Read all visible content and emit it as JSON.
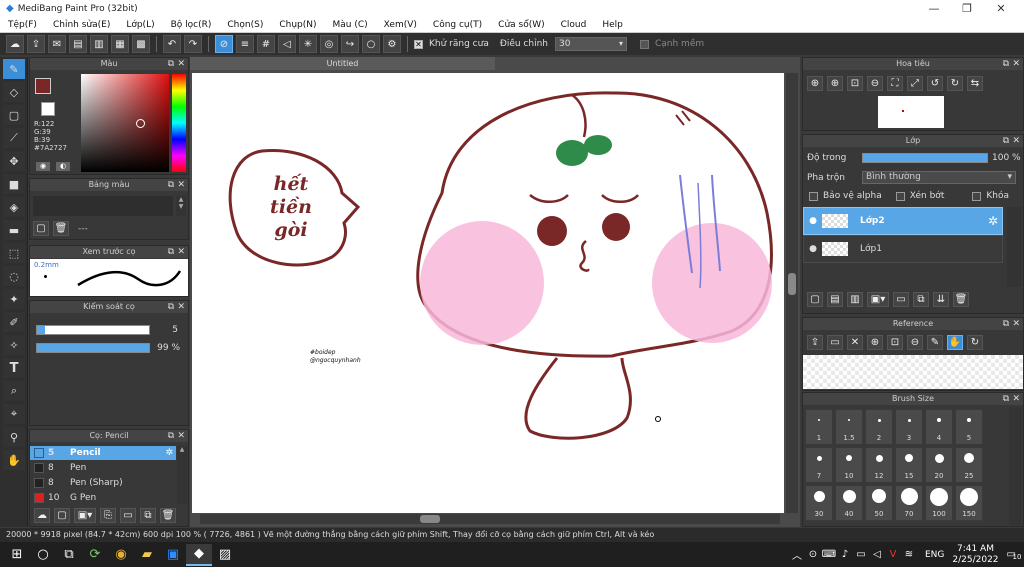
{
  "window": {
    "title": "MediBang Paint Pro (32bit)"
  },
  "menu": [
    "Tệp(F)",
    "Chỉnh sửa(E)",
    "Lớp(L)",
    "Bộ lọc(R)",
    "Chọn(S)",
    "Chụp(N)",
    "Màu (C)",
    "Xem(V)",
    "Công cụ(T)",
    "Cửa sổ(W)",
    "Cloud",
    "Help"
  ],
  "toolbar": {
    "antialias_label": "Khử răng cưa",
    "adjust_label": "Điều chỉnh",
    "adjust_value": "30",
    "edge_label": "Cạnh mềm"
  },
  "color_panel": {
    "title": "Màu",
    "r": "R:122",
    "g": "G:39",
    "b": "B:39",
    "hex": "#7A2727",
    "main_color": "#7a2727"
  },
  "swatch_panel": {
    "title": "Bảng màu",
    "extra": "---"
  },
  "preview_panel": {
    "title": "Xem trước cọ",
    "size": "0.2mm"
  },
  "brush_control": {
    "title": "Kiểm soát cọ",
    "size_value": "5",
    "opacity_value": "99 %"
  },
  "brush_list": {
    "title": "Cọ: Pencil",
    "items": [
      {
        "size": "5",
        "name": "Pencil"
      },
      {
        "size": "8",
        "name": "Pen"
      },
      {
        "size": "8",
        "name": "Pen (Sharp)"
      },
      {
        "size": "10",
        "name": "G Pen"
      }
    ]
  },
  "document": {
    "tab_title": "Untitled"
  },
  "artwork": {
    "bubble_lines": [
      "hết",
      "tiền",
      "gòi"
    ],
    "credit_1": "#boidep",
    "credit_2": "@ngocquynhanh"
  },
  "navigator": {
    "title": "Hoa tiêu"
  },
  "layer_panel": {
    "title": "Lớp",
    "opacity_label": "Độ trong",
    "opacity_value": "100 %",
    "blend_label": "Pha trộn",
    "blend_value": "Bình thường",
    "protect_alpha": "Bảo vệ alpha",
    "clipping": "Xén bớt",
    "lock": "Khóa",
    "layers": [
      "Lớp2",
      "Lớp1"
    ]
  },
  "reference_panel": {
    "title": "Reference"
  },
  "brush_size_panel": {
    "title": "Brush Size",
    "sizes": [
      "1",
      "1.5",
      "2",
      "3",
      "4",
      "5",
      "7",
      "10",
      "12",
      "15",
      "20",
      "25",
      "30",
      "40",
      "50",
      "70",
      "100",
      "150"
    ]
  },
  "status": {
    "text": "20000 * 9918 pixel   (84.7 * 42cm)   600 dpi   100 %   ( 7726, 4861 )   Vẽ một đường thẳng bằng cách giữ phím Shift, Thay đổi cỡ cọ bằng cách giữ phím Ctrl, Alt và kéo"
  },
  "taskbar": {
    "lang": "ENG",
    "time": "7:41 AM",
    "date": "2/25/2022",
    "notif": "10"
  }
}
